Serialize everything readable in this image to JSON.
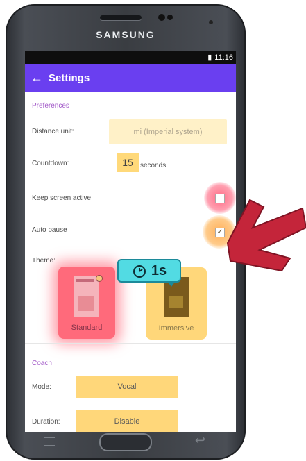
{
  "device": {
    "brand": "SAMSUNG"
  },
  "status": {
    "time": "11:16",
    "battery_glyph": "▮",
    "window_glyph": "■ ✕"
  },
  "appbar": {
    "back_glyph": "←",
    "title": "Settings"
  },
  "preferences": {
    "section": "Preferences",
    "distance_unit_label": "Distance unit:",
    "distance_unit_value": "mi (Imperial system)",
    "countdown_label": "Countdown:",
    "countdown_value": "15",
    "seconds_label": "seconds",
    "keep_screen_label": "Keep screen active",
    "auto_pause_label": "Auto pause",
    "auto_pause_mark": "✓",
    "theme_label": "Theme:",
    "themes": [
      "Standard",
      "Immersive"
    ]
  },
  "overlay": {
    "badge_text": "1s"
  },
  "coach": {
    "section": "Coach",
    "mode_label": "Mode:",
    "mode_value": "Vocal",
    "duration_label": "Duration:",
    "duration_value": "Disable"
  },
  "colors": {
    "appbar": "#6a3ff0",
    "accent": "#a259c8",
    "highlight": "#ffd77a",
    "heat": "#ff6a7b"
  }
}
